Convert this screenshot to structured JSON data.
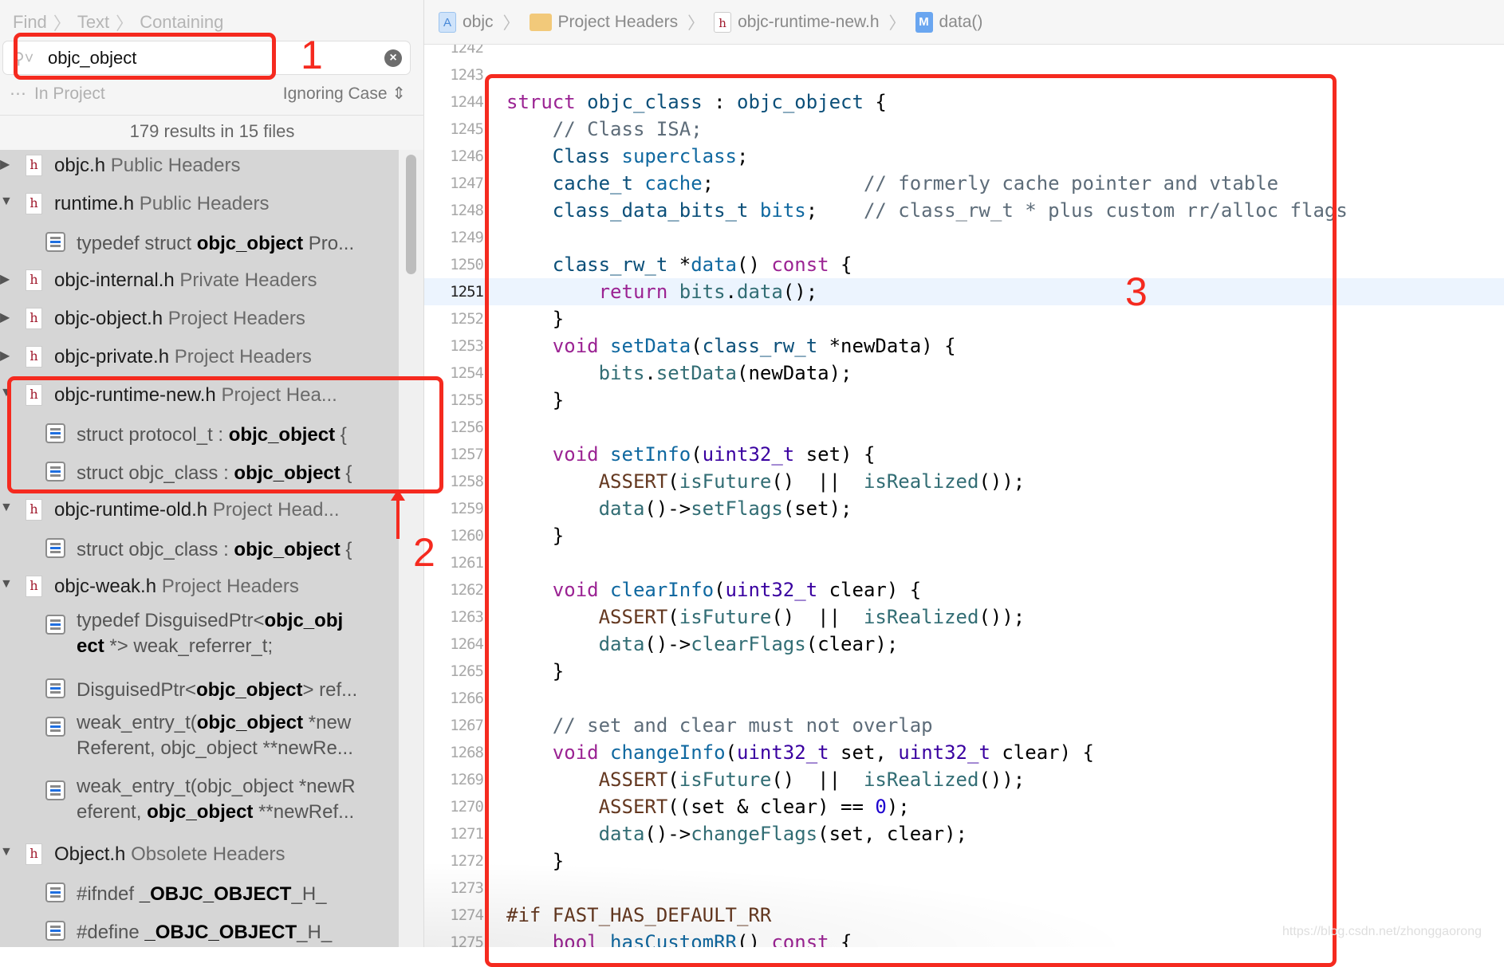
{
  "find_panel": {
    "breadcrumb": [
      "Find",
      "Text",
      "Containing"
    ],
    "search_value": "objc_object",
    "search_placeholder": "",
    "scope_label": "In Project",
    "case_label": "Ignoring Case",
    "results_summary": "179 results in 15 files",
    "tree": [
      {
        "kind": "file",
        "expanded": false,
        "name": "objc.h",
        "group": "Public Headers"
      },
      {
        "kind": "file",
        "expanded": true,
        "name": "runtime.h",
        "group": "Public Headers"
      },
      {
        "kind": "match",
        "lines": [
          [
            {
              "t": "typedef struct "
            },
            {
              "t": "objc_object",
              "b": true
            },
            {
              "t": " Pro..."
            }
          ]
        ]
      },
      {
        "kind": "file",
        "expanded": false,
        "name": "objc-internal.h",
        "group": "Private Headers"
      },
      {
        "kind": "file",
        "expanded": false,
        "name": "objc-object.h",
        "group": "Project Headers"
      },
      {
        "kind": "file",
        "expanded": false,
        "name": "objc-private.h",
        "group": "Project Headers"
      },
      {
        "kind": "file",
        "expanded": true,
        "name": "objc-runtime-new.h",
        "group": "Project Hea..."
      },
      {
        "kind": "match",
        "lines": [
          [
            {
              "t": "struct protocol_t : "
            },
            {
              "t": "objc_object",
              "b": true
            },
            {
              "t": " {"
            }
          ]
        ]
      },
      {
        "kind": "match",
        "lines": [
          [
            {
              "t": "struct objc_class : "
            },
            {
              "t": "objc_object",
              "b": true
            },
            {
              "t": " {"
            }
          ]
        ]
      },
      {
        "kind": "file",
        "expanded": true,
        "name": "objc-runtime-old.h",
        "group": "Project Head..."
      },
      {
        "kind": "match",
        "lines": [
          [
            {
              "t": "struct objc_class : "
            },
            {
              "t": "objc_object",
              "b": true
            },
            {
              "t": " {"
            }
          ]
        ]
      },
      {
        "kind": "file",
        "expanded": true,
        "name": "objc-weak.h",
        "group": "Project Headers"
      },
      {
        "kind": "match",
        "lines": [
          [
            {
              "t": "typedef DisguisedPtr<"
            },
            {
              "t": "objc_obj",
              "b": true
            }
          ],
          [
            {
              "t": "ect",
              "b": true
            },
            {
              "t": " *> weak_referrer_t;"
            }
          ]
        ]
      },
      {
        "kind": "match",
        "lines": [
          [
            {
              "t": "DisguisedPtr<"
            },
            {
              "t": "objc_object",
              "b": true
            },
            {
              "t": "> ref..."
            }
          ]
        ]
      },
      {
        "kind": "match",
        "lines": [
          [
            {
              "t": "weak_entry_t("
            },
            {
              "t": "objc_object",
              "b": true
            },
            {
              "t": " *new"
            }
          ],
          [
            {
              "t": "Referent, objc_object **newRe..."
            }
          ]
        ]
      },
      {
        "kind": "match",
        "lines": [
          [
            {
              "t": "weak_entry_t(objc_object *newR"
            }
          ],
          [
            {
              "t": "eferent, "
            },
            {
              "t": "objc_object",
              "b": true
            },
            {
              "t": " **newRef..."
            }
          ]
        ]
      },
      {
        "kind": "file",
        "expanded": true,
        "name": "Object.h",
        "group": "Obsolete Headers"
      },
      {
        "kind": "match",
        "lines": [
          [
            {
              "t": "#ifndef "
            },
            {
              "t": "_OBJC_OBJECT",
              "b": true
            },
            {
              "t": "_H_"
            }
          ]
        ]
      },
      {
        "kind": "match",
        "lines": [
          [
            {
              "t": "#define "
            },
            {
              "t": "_OBJC_OBJECT",
              "b": true
            },
            {
              "t": "_H_"
            }
          ]
        ]
      }
    ]
  },
  "editor": {
    "breadcrumb": [
      {
        "icon": "project-icon",
        "label": "objc"
      },
      {
        "icon": "folder-icon",
        "label": "Project Headers"
      },
      {
        "icon": "header-file-icon",
        "label": "objc-runtime-new.h"
      },
      {
        "icon": "method-icon",
        "label": "data()"
      }
    ],
    "current_line": 1251,
    "lines": [
      {
        "n": 1242,
        "tok": []
      },
      {
        "n": 1243,
        "tok": []
      },
      {
        "n": 1244,
        "tok": [
          [
            "k",
            "struct"
          ],
          [
            "x",
            " "
          ],
          [
            "t",
            "objc_class"
          ],
          [
            "x",
            " : "
          ],
          [
            "t",
            "objc_object"
          ],
          [
            "x",
            " {"
          ]
        ]
      },
      {
        "n": 1245,
        "tok": [
          [
            "x",
            "    "
          ],
          [
            "m",
            "// Class ISA;"
          ]
        ]
      },
      {
        "n": 1246,
        "tok": [
          [
            "x",
            "    "
          ],
          [
            "t",
            "Class"
          ],
          [
            "x",
            " "
          ],
          [
            "d",
            "superclass"
          ],
          [
            "x",
            ";"
          ]
        ]
      },
      {
        "n": 1247,
        "tok": [
          [
            "x",
            "    "
          ],
          [
            "t",
            "cache_t"
          ],
          [
            "x",
            " "
          ],
          [
            "d",
            "cache"
          ],
          [
            "x",
            ";             "
          ],
          [
            "m",
            "// formerly cache pointer and vtable"
          ]
        ]
      },
      {
        "n": 1248,
        "tok": [
          [
            "x",
            "    "
          ],
          [
            "t",
            "class_data_bits_t"
          ],
          [
            "x",
            " "
          ],
          [
            "d",
            "bits"
          ],
          [
            "x",
            ";    "
          ],
          [
            "m",
            "// class_rw_t * plus custom rr/alloc flags"
          ]
        ]
      },
      {
        "n": 1249,
        "tok": []
      },
      {
        "n": 1250,
        "tok": [
          [
            "x",
            "    "
          ],
          [
            "t",
            "class_rw_t"
          ],
          [
            "x",
            " *"
          ],
          [
            "d",
            "data"
          ],
          [
            "x",
            "() "
          ],
          [
            "k",
            "const"
          ],
          [
            "x",
            " {"
          ]
        ]
      },
      {
        "n": 1251,
        "tok": [
          [
            "x",
            "        "
          ],
          [
            "k",
            "return"
          ],
          [
            "x",
            " "
          ],
          [
            "c",
            "bits"
          ],
          [
            "x",
            "."
          ],
          [
            "c",
            "data"
          ],
          [
            "x",
            "();"
          ]
        ]
      },
      {
        "n": 1252,
        "tok": [
          [
            "x",
            "    }"
          ]
        ]
      },
      {
        "n": 1253,
        "tok": [
          [
            "x",
            "    "
          ],
          [
            "k",
            "void"
          ],
          [
            "x",
            " "
          ],
          [
            "d",
            "setData"
          ],
          [
            "x",
            "("
          ],
          [
            "t",
            "class_rw_t"
          ],
          [
            "x",
            " *newData) {"
          ]
        ]
      },
      {
        "n": 1254,
        "tok": [
          [
            "x",
            "        "
          ],
          [
            "c",
            "bits"
          ],
          [
            "x",
            "."
          ],
          [
            "c",
            "setData"
          ],
          [
            "x",
            "(newData);"
          ]
        ]
      },
      {
        "n": 1255,
        "tok": [
          [
            "x",
            "    }"
          ]
        ]
      },
      {
        "n": 1256,
        "tok": []
      },
      {
        "n": 1257,
        "tok": [
          [
            "x",
            "    "
          ],
          [
            "k",
            "void"
          ],
          [
            "x",
            " "
          ],
          [
            "d",
            "setInfo"
          ],
          [
            "x",
            "("
          ],
          [
            "s",
            "uint32_t"
          ],
          [
            "x",
            " set) {"
          ]
        ]
      },
      {
        "n": 1258,
        "tok": [
          [
            "x",
            "        "
          ],
          [
            "p",
            "ASSERT"
          ],
          [
            "x",
            "("
          ],
          [
            "c",
            "isFuture"
          ],
          [
            "x",
            "()  ||  "
          ],
          [
            "c",
            "isRealized"
          ],
          [
            "x",
            "());"
          ]
        ]
      },
      {
        "n": 1259,
        "tok": [
          [
            "x",
            "        "
          ],
          [
            "c",
            "data"
          ],
          [
            "x",
            "()->"
          ],
          [
            "c",
            "setFlags"
          ],
          [
            "x",
            "(set);"
          ]
        ]
      },
      {
        "n": 1260,
        "tok": [
          [
            "x",
            "    }"
          ]
        ]
      },
      {
        "n": 1261,
        "tok": []
      },
      {
        "n": 1262,
        "tok": [
          [
            "x",
            "    "
          ],
          [
            "k",
            "void"
          ],
          [
            "x",
            " "
          ],
          [
            "d",
            "clearInfo"
          ],
          [
            "x",
            "("
          ],
          [
            "s",
            "uint32_t"
          ],
          [
            "x",
            " clear) {"
          ]
        ]
      },
      {
        "n": 1263,
        "tok": [
          [
            "x",
            "        "
          ],
          [
            "p",
            "ASSERT"
          ],
          [
            "x",
            "("
          ],
          [
            "c",
            "isFuture"
          ],
          [
            "x",
            "()  ||  "
          ],
          [
            "c",
            "isRealized"
          ],
          [
            "x",
            "());"
          ]
        ]
      },
      {
        "n": 1264,
        "tok": [
          [
            "x",
            "        "
          ],
          [
            "c",
            "data"
          ],
          [
            "x",
            "()->"
          ],
          [
            "c",
            "clearFlags"
          ],
          [
            "x",
            "(clear);"
          ]
        ]
      },
      {
        "n": 1265,
        "tok": [
          [
            "x",
            "    }"
          ]
        ]
      },
      {
        "n": 1266,
        "tok": []
      },
      {
        "n": 1267,
        "tok": [
          [
            "x",
            "    "
          ],
          [
            "m",
            "// set and clear must not overlap"
          ]
        ]
      },
      {
        "n": 1268,
        "tok": [
          [
            "x",
            "    "
          ],
          [
            "k",
            "void"
          ],
          [
            "x",
            " "
          ],
          [
            "d",
            "changeInfo"
          ],
          [
            "x",
            "("
          ],
          [
            "s",
            "uint32_t"
          ],
          [
            "x",
            " set, "
          ],
          [
            "s",
            "uint32_t"
          ],
          [
            "x",
            " clear) {"
          ]
        ]
      },
      {
        "n": 1269,
        "tok": [
          [
            "x",
            "        "
          ],
          [
            "p",
            "ASSERT"
          ],
          [
            "x",
            "("
          ],
          [
            "c",
            "isFuture"
          ],
          [
            "x",
            "()  ||  "
          ],
          [
            "c",
            "isRealized"
          ],
          [
            "x",
            "());"
          ]
        ]
      },
      {
        "n": 1270,
        "tok": [
          [
            "x",
            "        "
          ],
          [
            "p",
            "ASSERT"
          ],
          [
            "x",
            "((set & clear) == "
          ],
          [
            "n",
            "0"
          ],
          [
            "x",
            ");"
          ]
        ]
      },
      {
        "n": 1271,
        "tok": [
          [
            "x",
            "        "
          ],
          [
            "c",
            "data"
          ],
          [
            "x",
            "()->"
          ],
          [
            "c",
            "changeFlags"
          ],
          [
            "x",
            "(set, clear);"
          ]
        ]
      },
      {
        "n": 1272,
        "tok": [
          [
            "x",
            "    }"
          ]
        ]
      },
      {
        "n": 1273,
        "tok": []
      },
      {
        "n": 1274,
        "tok": [
          [
            "p",
            "#if FAST_HAS_DEFAULT_RR"
          ]
        ]
      },
      {
        "n": 1275,
        "tok": [
          [
            "x",
            "    "
          ],
          [
            "k",
            "bool"
          ],
          [
            "x",
            " "
          ],
          [
            "d",
            "hasCustomRR"
          ],
          [
            "x",
            "() "
          ],
          [
            "k",
            "const"
          ],
          [
            "x",
            " {"
          ]
        ]
      }
    ]
  },
  "annotations": {
    "label1": "1",
    "label2": "2",
    "label3": "3",
    "color": "#f52a1f"
  },
  "watermark": "https://blog.csdn.net/zhonggaorong"
}
